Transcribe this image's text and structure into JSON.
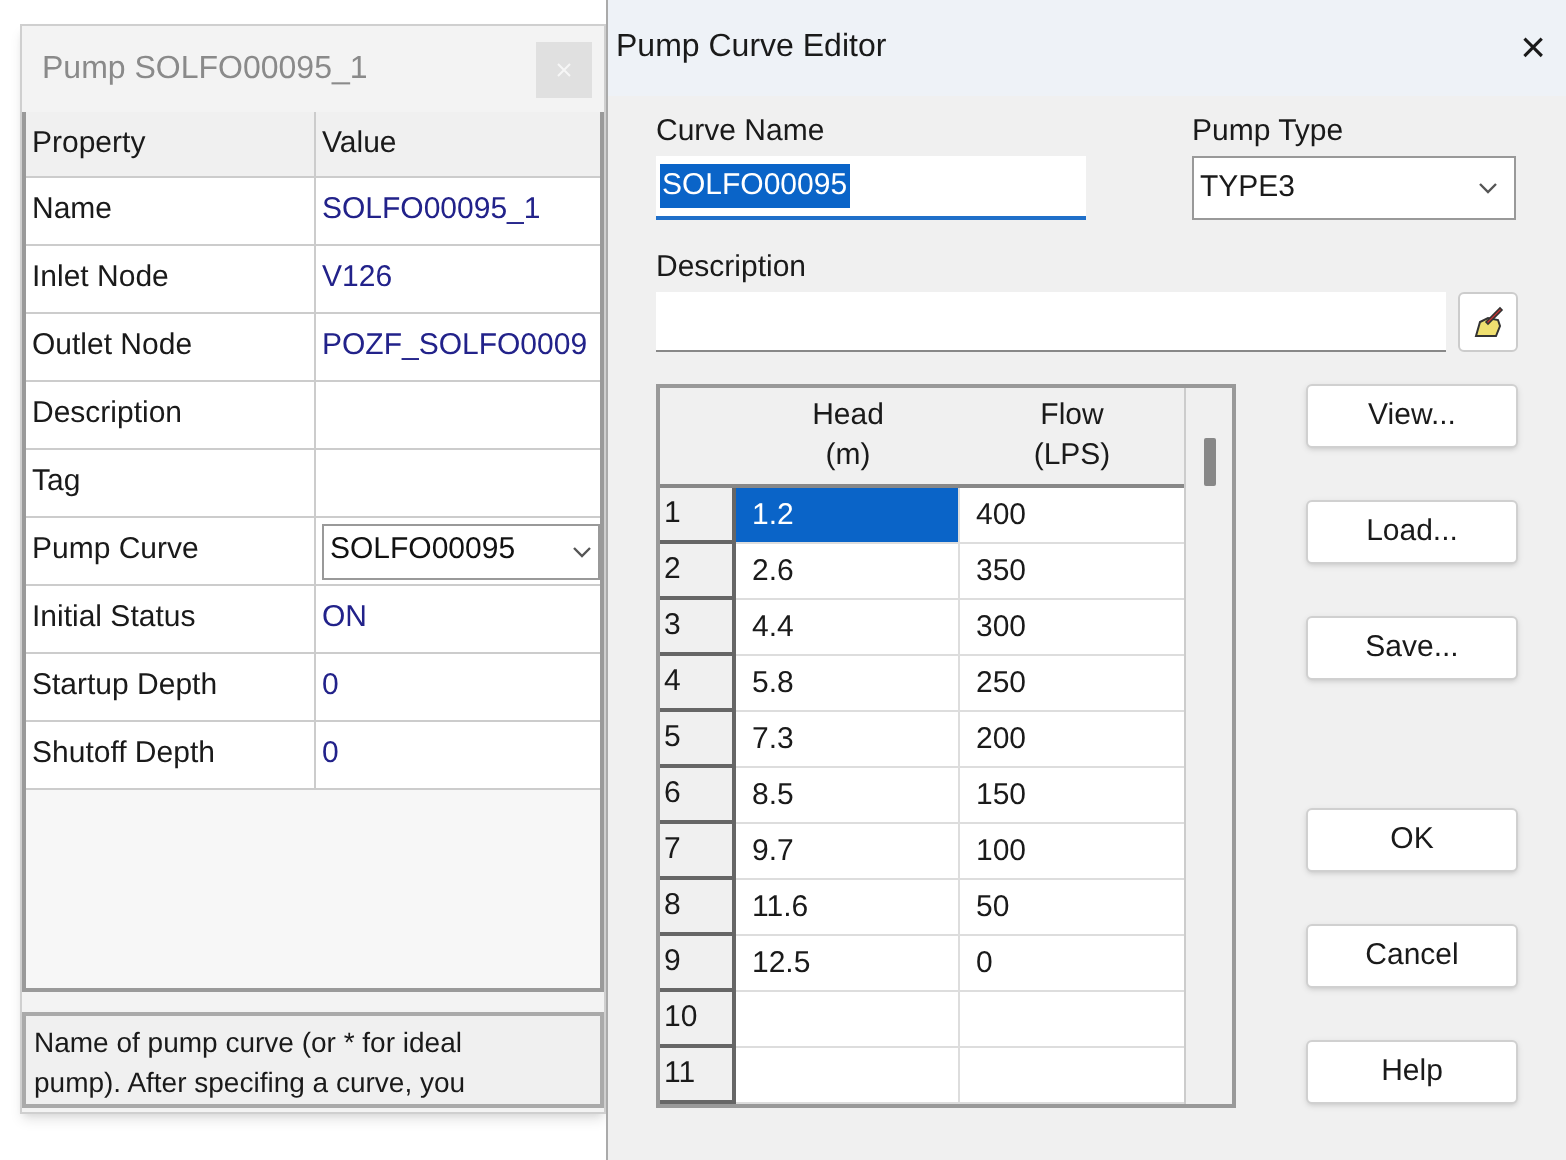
{
  "property_window": {
    "title": "Pump SOLFO00095_1",
    "columns": [
      "Property",
      "Value"
    ],
    "rows": [
      {
        "kind": "text",
        "property": "Name",
        "value": "SOLFO00095_1"
      },
      {
        "kind": "text",
        "property": "Inlet Node",
        "value": "V126"
      },
      {
        "kind": "text",
        "property": "Outlet Node",
        "value": "POZF_SOLFO0009"
      },
      {
        "kind": "text",
        "property": "Description"
      },
      {
        "kind": "text",
        "property": "Tag"
      },
      {
        "kind": "dropdown",
        "property": "Pump Curve",
        "value": "SOLFO00095"
      },
      {
        "kind": "text",
        "property": "Initial Status",
        "value": "ON"
      },
      {
        "kind": "text",
        "property": "Startup Depth",
        "value": "0"
      },
      {
        "kind": "text",
        "property": "Shutoff Depth",
        "value": "0"
      }
    ],
    "hint": "Name of pump curve (or * for ideal pump). After specifing a curve, you"
  },
  "editor": {
    "title": "Pump Curve Editor",
    "close": "×",
    "curve_name": {
      "label": "Curve Name",
      "value": "SOLFO00095",
      "text_selected": true
    },
    "pump_type": {
      "label": "Pump Type",
      "value": "TYPE3"
    },
    "description": {
      "label": "Description"
    },
    "table": {
      "columns": [
        {
          "name": "Head",
          "unit": "(m)"
        },
        {
          "name": "Flow",
          "unit": "(LPS)"
        }
      ],
      "rows": [
        {
          "index": "1",
          "head": "1.2",
          "flow": "400",
          "selected": true
        },
        {
          "index": "2",
          "head": "2.6",
          "flow": "350",
          "selected": false
        },
        {
          "index": "3",
          "head": "4.4",
          "flow": "300",
          "selected": false
        },
        {
          "index": "4",
          "head": "5.8",
          "flow": "250",
          "selected": false
        },
        {
          "index": "5",
          "head": "7.3",
          "flow": "200",
          "selected": false
        },
        {
          "index": "6",
          "head": "8.5",
          "flow": "150",
          "selected": false
        },
        {
          "index": "7",
          "head": "9.7",
          "flow": "100",
          "selected": false
        },
        {
          "index": "8",
          "head": "11.6",
          "flow": "50",
          "selected": false
        },
        {
          "index": "9",
          "head": "12.5",
          "flow": "0",
          "selected": false
        },
        {
          "index": "10",
          "selected": false
        },
        {
          "index": "11",
          "selected": false
        }
      ]
    },
    "file_buttons": [
      "View...",
      "Load...",
      "Save..."
    ],
    "dialog_buttons": [
      "OK",
      "Cancel",
      "Help"
    ]
  }
}
